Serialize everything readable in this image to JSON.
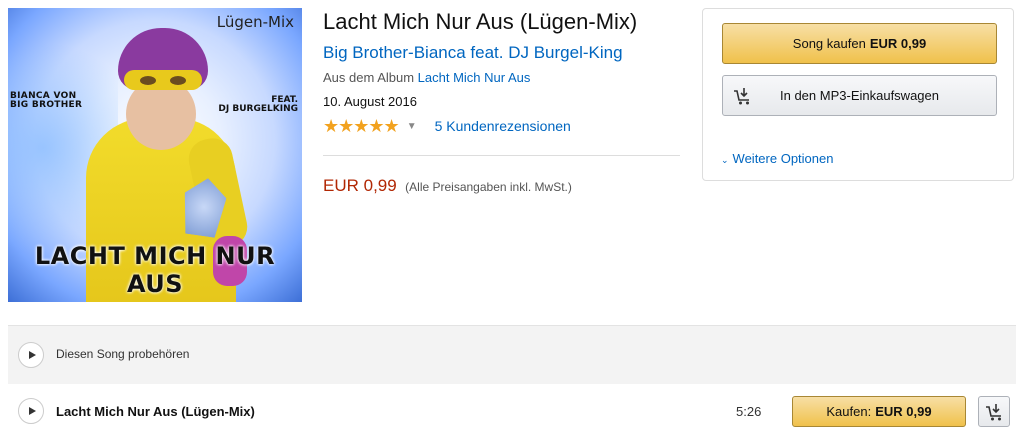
{
  "album_art": {
    "label_mix": "Lügen-Mix",
    "label_left": [
      "BIANCA VON",
      "BIG BROTHER"
    ],
    "label_right": [
      "FEAT.",
      "DJ BURGELKING"
    ],
    "label_bottom": "LACHT MICH NUR AUS"
  },
  "product": {
    "title": "Lacht Mich Nur Aus (Lügen-Mix)",
    "artist": "Big Brother-Bianca feat. DJ Burgel-King",
    "album_prefix": "Aus dem Album",
    "album_link": "Lacht Mich Nur Aus",
    "date": "10. August 2016",
    "stars": "★★★★★",
    "rating_value": 5,
    "reviews": "5 Kundenrezensionen",
    "price": "EUR 0,99",
    "price_note": "(Alle Preisangaben inkl. MwSt.)"
  },
  "buybox": {
    "buy_label": "Song kaufen",
    "buy_price": "EUR 0,99",
    "cart_label": "In den MP3-Einkaufswagen",
    "more_options": "Weitere Optionen"
  },
  "preview": {
    "label": "Diesen Song probehören"
  },
  "track": {
    "title": "Lacht Mich Nur Aus (Lügen-Mix)",
    "duration": "5:26",
    "buy_label": "Kaufen:",
    "buy_price": "EUR 0,99"
  },
  "colors": {
    "link": "#0066c0",
    "price": "#b12704",
    "star": "#f2a21f",
    "buy_button": "#f0c14b"
  },
  "icons": [
    "play-icon",
    "cart-add-icon",
    "chevron-down-icon",
    "caret-down-icon"
  ]
}
